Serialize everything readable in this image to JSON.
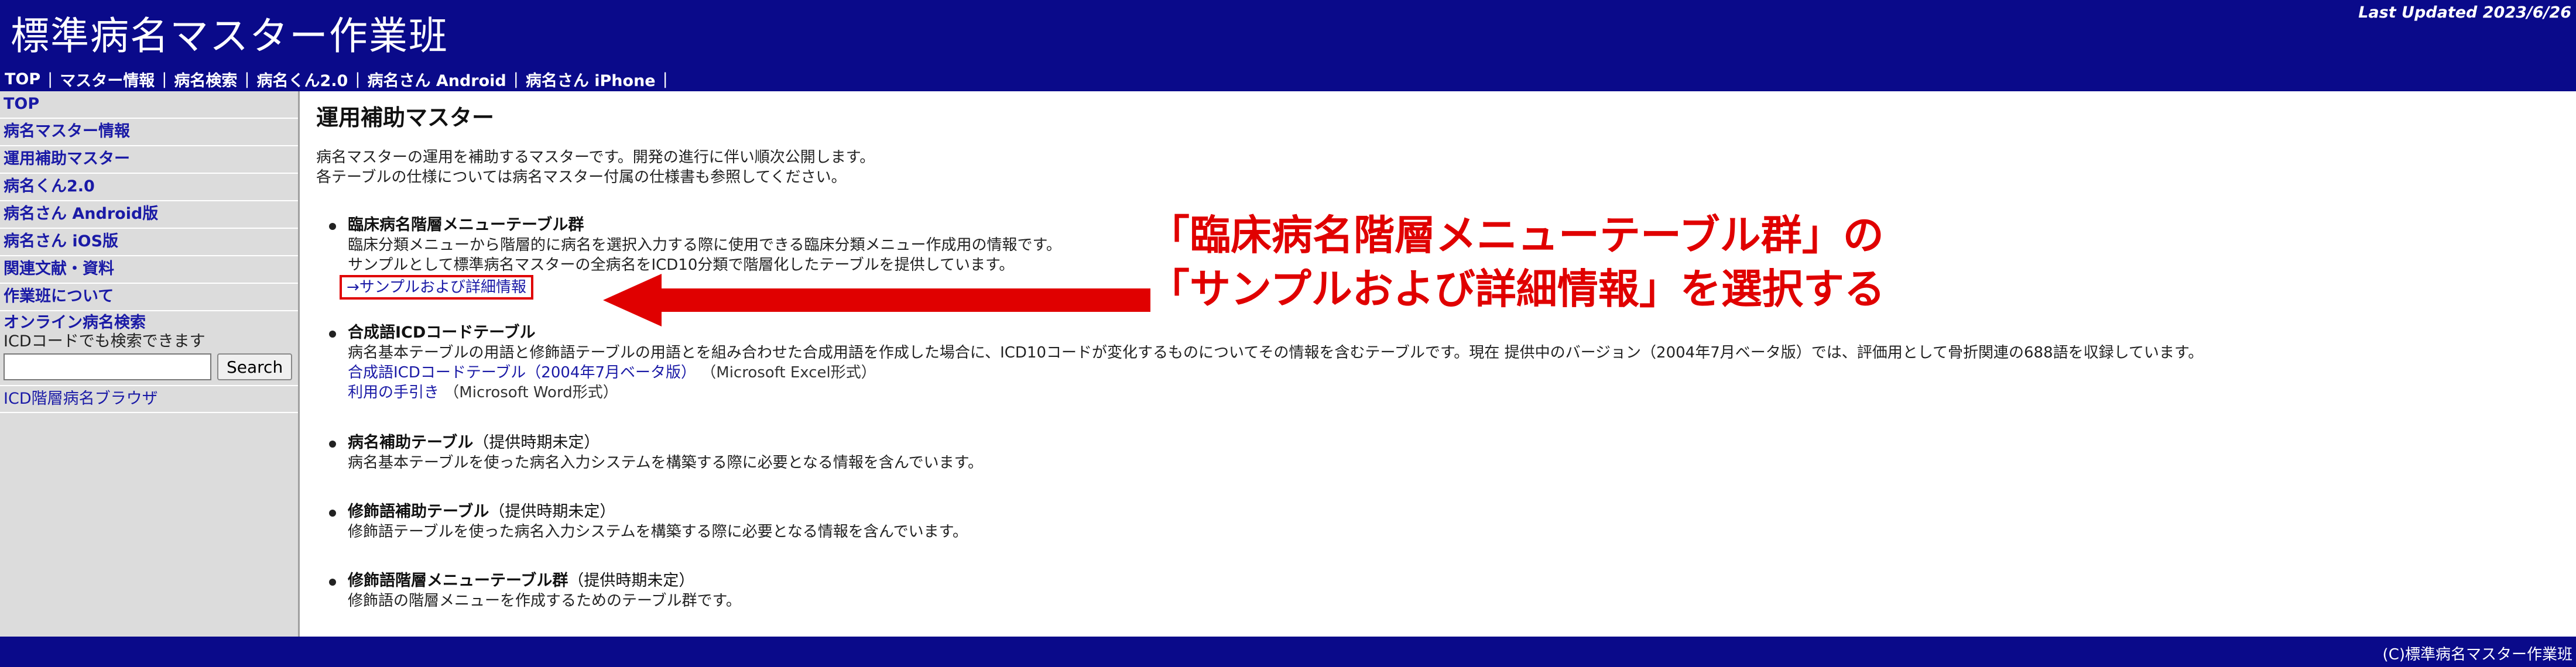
{
  "header": {
    "site_title": "標準病名マスター作業班",
    "last_updated": "Last Updated 2023/6/26"
  },
  "topnav": {
    "items": [
      "TOP",
      "マスター情報",
      "病名検索",
      "病名くん2.0",
      "病名さん Android",
      "病名さん iPhone"
    ],
    "separator": "|"
  },
  "sidebar": {
    "items": [
      "TOP",
      "病名マスター情報",
      "運用補助マスター",
      "病名くん2.0",
      "病名さん Android版",
      "病名さん iOS版",
      "関連文献・資料",
      "作業班について"
    ],
    "online_search": {
      "title": "オンライン病名検索",
      "note": "ICDコードでも検索できます",
      "input_value": "",
      "button_label": "Search"
    },
    "icd_browser": "ICD階層病名ブラウザ"
  },
  "main": {
    "title": "運用補助マスター",
    "intro": [
      "病名マスターの運用を補助するマスターです。開発の進行に伴い順次公開します。",
      "各テーブルの仕様については病名マスター付属の仕様書も参照してください。"
    ],
    "sections": [
      {
        "title": "臨床病名階層メニューテーブル群",
        "lines": [
          "臨床分類メニューから階層的に病名を選択入力する際に使用できる臨床分類メニュー作成用の情報です。",
          "サンプルとして標準病名マスターの全病名をICD10分類で階層化したテーブルを提供しています。"
        ],
        "link": "→サンプルおよび詳細情報"
      },
      {
        "title": "合成語ICDコードテーブル",
        "lines": [
          "病名基本テーブルの用語と修飾語テーブルの用語とを組み合わせた合成用語を作成した場合に、ICD10コードが変化するものについてその情報を含むテーブルです。現在 提供中のバージョン（2004年7月ベータ版）では、評価用として骨折関連の688語を収録しています。"
        ],
        "links": [
          {
            "label": "合成語ICDコードテーブル（2004年7月ベータ版）",
            "note": "（Microsoft Excel形式）"
          },
          {
            "label": "利用の手引き",
            "note": "（Microsoft Word形式）"
          }
        ]
      },
      {
        "title": "病名補助テーブル",
        "status": "（提供時期未定）",
        "lines": [
          "病名基本テーブルを使った病名入力システムを構築する際に必要となる情報を含んでいます。"
        ]
      },
      {
        "title": "修飾語補助テーブル",
        "status": "（提供時期未定）",
        "lines": [
          "修飾語テーブルを使った病名入力システムを構築する際に必要となる情報を含んでいます。"
        ]
      },
      {
        "title": "修飾語階層メニューテーブル群",
        "status": "（提供時期未定）",
        "lines": [
          "修飾語の階層メニューを作成するためのテーブル群です。"
        ]
      }
    ]
  },
  "annotation": {
    "line1": "「臨床病名階層メニューテーブル群」の",
    "line2": "「サンプルおよび詳細情報」を選択する",
    "color": "#e00000"
  },
  "footer": {
    "copyright": "(C)標準病名マスター作業班"
  },
  "colors": {
    "header_bg": "#0a0a8a",
    "sidebar_bg": "#dcdcdc",
    "link": "#1a1aa6"
  }
}
